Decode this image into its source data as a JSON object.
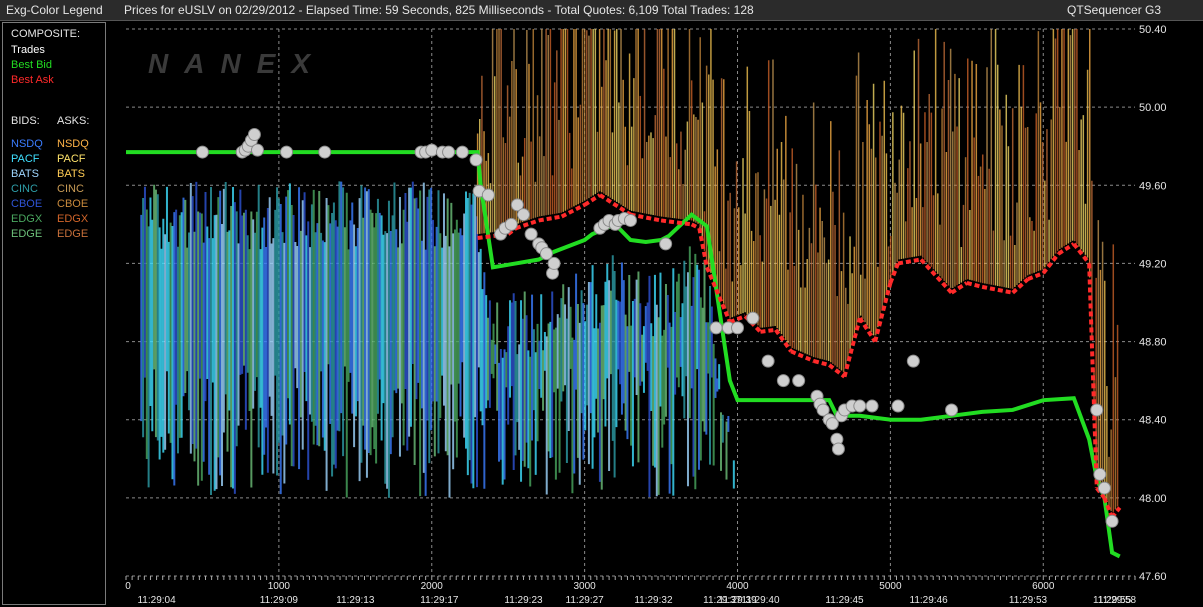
{
  "header": {
    "legend_title": "Exg-Color Legend",
    "chart_title": "Prices for  eUSLV  on  02/29/2012  -  Elapsed Time: 59 Seconds, 825 Milliseconds  -  Total Quotes: 6,109  Total Trades: 128",
    "app_name": "QTSequencer G3"
  },
  "legend": {
    "composite_title": "COMPOSITE:",
    "composite": [
      {
        "label": "Trades",
        "color": "#ffffff"
      },
      {
        "label": "Best Bid",
        "color": "#22dd22"
      },
      {
        "label": "Best Ask",
        "color": "#ff2a2a"
      }
    ],
    "bids_title": "BIDS:",
    "asks_title": "ASKS:",
    "bids": [
      {
        "label": "NSDQ",
        "color": "#3b7dff"
      },
      {
        "label": "PACF",
        "color": "#3fe0ff"
      },
      {
        "label": "BATS",
        "color": "#9fd6ff"
      },
      {
        "label": "CINC",
        "color": "#2e9ea8"
      },
      {
        "label": "CBOE",
        "color": "#2f54d6"
      },
      {
        "label": "EDGX",
        "color": "#4aa860"
      },
      {
        "label": "EDGE",
        "color": "#6dc07a"
      }
    ],
    "asks": [
      {
        "label": "NSDQ",
        "color": "#ffb347"
      },
      {
        "label": "PACF",
        "color": "#ffe36b"
      },
      {
        "label": "BATS",
        "color": "#ffcc55"
      },
      {
        "label": "CINC",
        "color": "#c79a55"
      },
      {
        "label": "CBOE",
        "color": "#c98a3c"
      },
      {
        "label": "EDGX",
        "color": "#d2652a"
      },
      {
        "label": "EDGE",
        "color": "#c8703a"
      }
    ]
  },
  "chart_data": {
    "type": "line",
    "watermark": "NANEX",
    "xlim": [
      0,
      6600
    ],
    "ylim": [
      47.6,
      50.4
    ],
    "y_ticks": [
      "47.60",
      "48.00",
      "48.40",
      "48.80",
      "49.20",
      "49.60",
      "50.00",
      "50.40"
    ],
    "x_ticks": [
      "0",
      "1000",
      "2000",
      "3000",
      "4000",
      "5000",
      "6000"
    ],
    "x_tick_values": [
      0,
      1000,
      2000,
      3000,
      4000,
      5000,
      6000
    ],
    "time_labels": [
      "11:29:04",
      "11:29:09",
      "11:29:13",
      "11:29:17",
      "11:29:23",
      "11:29:27",
      "11:29:32",
      "11:29:37",
      "11:29:39",
      "11:29:40",
      "11:29:45",
      "11:29:46",
      "11:29:53",
      "11:29:55",
      "11:29:58"
    ],
    "time_label_x": [
      200,
      1000,
      1500,
      2050,
      2600,
      3000,
      3450,
      3900,
      4000,
      4150,
      4700,
      5250,
      5900,
      6450,
      6600
    ],
    "grid": true,
    "series": [
      {
        "name": "Best Bid",
        "x": [
          0,
          2300,
          2320,
          2400,
          2550,
          2700,
          2800,
          3000,
          3050,
          3200,
          3300,
          3400,
          3500,
          3550,
          3700,
          3800,
          3950,
          4000,
          4050,
          4200,
          4300,
          4400,
          4500,
          4600,
          4650,
          4800,
          4900,
          5000,
          5200,
          5400,
          5600,
          5800,
          6000,
          6200,
          6300,
          6350,
          6400,
          6450,
          6500
        ],
        "y": [
          49.77,
          49.77,
          49.6,
          49.18,
          49.2,
          49.22,
          49.26,
          49.32,
          49.35,
          49.4,
          49.32,
          49.31,
          49.32,
          49.34,
          49.45,
          49.39,
          48.6,
          48.5,
          48.5,
          48.5,
          48.5,
          48.5,
          48.5,
          48.5,
          48.42,
          48.42,
          48.41,
          48.4,
          48.4,
          48.42,
          48.44,
          48.45,
          48.5,
          48.51,
          48.3,
          48.1,
          48.0,
          47.72,
          47.7
        ]
      },
      {
        "name": "Best Ask",
        "x": [
          2300,
          2500,
          2550,
          2700,
          2850,
          3000,
          3100,
          3300,
          3500,
          3700,
          3750,
          3800,
          3950,
          4050,
          4150,
          4250,
          4350,
          4500,
          4600,
          4700,
          4800,
          4900,
          5000,
          5050,
          5200,
          5400,
          5500,
          5600,
          5800,
          5900,
          6000,
          6100,
          6200,
          6300,
          6350,
          6400,
          6450,
          6500
        ],
        "y": [
          49.33,
          49.35,
          49.38,
          49.42,
          49.44,
          49.5,
          49.55,
          49.45,
          49.42,
          49.4,
          49.38,
          49.18,
          48.9,
          48.93,
          48.85,
          48.86,
          48.75,
          48.7,
          48.68,
          48.62,
          48.92,
          48.8,
          49.1,
          49.2,
          49.22,
          49.05,
          49.1,
          49.08,
          49.05,
          49.12,
          49.15,
          49.25,
          49.3,
          49.2,
          48.05,
          48.0,
          47.9,
          47.95
        ]
      },
      {
        "name": "Trades",
        "x": [
          500,
          760,
          780,
          800,
          820,
          840,
          860,
          1050,
          1300,
          1930,
          1960,
          2000,
          2070,
          2110,
          2200,
          2290,
          2310,
          2370,
          2450,
          2480,
          2520,
          2560,
          2600,
          2650,
          2700,
          2720,
          2750,
          2790,
          2800,
          3100,
          3130,
          3160,
          3200,
          3220,
          3260,
          3300,
          3530,
          3860,
          3940,
          4000,
          4100,
          4200,
          4300,
          4400,
          4520,
          4540,
          4560,
          4600,
          4620,
          4650,
          4660,
          4680,
          4700,
          4750,
          4800,
          4880,
          5050,
          5150,
          5400,
          6350,
          6370,
          6400,
          6450
        ],
        "y": [
          49.77,
          49.77,
          49.78,
          49.8,
          49.83,
          49.86,
          49.78,
          49.77,
          49.77,
          49.77,
          49.77,
          49.78,
          49.77,
          49.77,
          49.77,
          49.73,
          49.57,
          49.55,
          49.35,
          49.38,
          49.4,
          49.5,
          49.45,
          49.35,
          49.3,
          49.28,
          49.25,
          49.15,
          49.2,
          49.38,
          49.4,
          49.42,
          49.4,
          49.42,
          49.43,
          49.42,
          49.3,
          48.87,
          48.87,
          48.87,
          48.92,
          48.7,
          48.6,
          48.6,
          48.52,
          48.48,
          48.45,
          48.4,
          48.38,
          48.3,
          48.25,
          48.42,
          48.45,
          48.47,
          48.47,
          48.47,
          48.47,
          48.7,
          48.45,
          48.45,
          48.12,
          48.05,
          47.88
        ]
      }
    ]
  }
}
